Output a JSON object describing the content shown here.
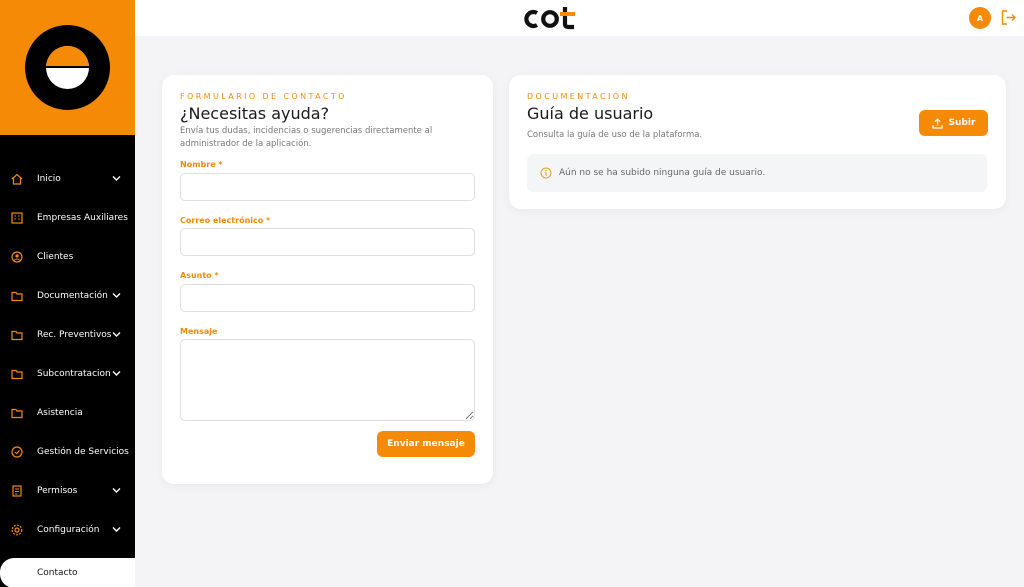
{
  "app": {
    "brand": "cot",
    "user_initial": "A"
  },
  "colors": {
    "accent": "#f58a07",
    "sidebar": "#000000",
    "background": "#f4f4f6"
  },
  "sidebar": {
    "items": [
      {
        "label": "Inicio",
        "icon": "home-icon",
        "has_submenu": true
      },
      {
        "label": "Empresas Auxiliares",
        "icon": "building-icon",
        "has_submenu": false
      },
      {
        "label": "Clientes",
        "icon": "clients-icon",
        "has_submenu": false
      },
      {
        "label": "Documentación",
        "icon": "folder-icon",
        "has_submenu": true
      },
      {
        "label": "Rec. Preventivos",
        "icon": "folder-icon",
        "has_submenu": true
      },
      {
        "label": "Subcontratacion",
        "icon": "folder-icon",
        "has_submenu": true
      },
      {
        "label": "Asistencia",
        "icon": "folder-icon",
        "has_submenu": false
      },
      {
        "label": "Gestión de Servicios",
        "icon": "services-icon",
        "has_submenu": false
      },
      {
        "label": "Permisos",
        "icon": "document-icon",
        "has_submenu": true
      },
      {
        "label": "Configuración",
        "icon": "gear-icon",
        "has_submenu": true
      },
      {
        "label": "Contacto",
        "icon": "",
        "has_submenu": false,
        "active": true
      }
    ]
  },
  "contact_form": {
    "eyebrow": "Formulario de contacto",
    "title": "¿Necesitas ayuda?",
    "description": "Envía tus dudas, incidencias o sugerencias directamente al administrador de la aplicación.",
    "fields": {
      "name_label": "Nombre *",
      "email_label": "Correo electrónico *",
      "subject_label": "Asunto *",
      "message_label": "Mensaje",
      "name_value": "",
      "email_value": "",
      "subject_value": "",
      "message_value": ""
    },
    "submit_label": "Enviar mensaje"
  },
  "documentation": {
    "eyebrow": "Documentación",
    "title": "Guía de usuario",
    "description": "Consulta la guía de uso de la plataforma.",
    "upload_label": "Subir",
    "notice": "Aún no se ha subido ninguna guía de usuario."
  }
}
